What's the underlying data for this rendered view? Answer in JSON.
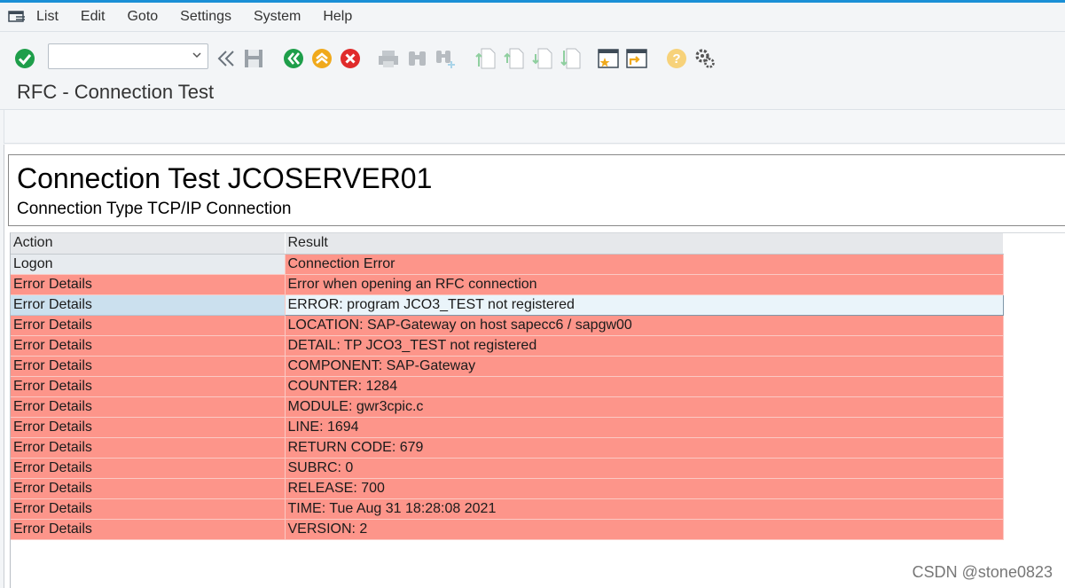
{
  "menu": [
    "List",
    "Edit",
    "Goto",
    "Settings",
    "System",
    "Help"
  ],
  "toolbar": {
    "command_value": "",
    "icons": [
      "enter-icon",
      "back-double-icon",
      "save-icon",
      "back-icon",
      "exit-icon",
      "cancel-icon",
      "print-icon",
      "find-icon",
      "find-next-icon",
      "first-page-icon",
      "previous-page-icon",
      "next-page-icon",
      "last-page-icon",
      "create-session-icon",
      "shortcut-icon",
      "help-icon",
      "customize-icon"
    ]
  },
  "title": "RFC - Connection Test",
  "report": {
    "heading": "Connection Test JCOSERVER01",
    "subheading": "Connection Type TCP/IP Connection"
  },
  "table": {
    "columns": [
      "Action",
      "Result"
    ],
    "rows": [
      {
        "action": "Logon",
        "result": "Connection Error"
      },
      {
        "action": "Error Details",
        "result": "Error when opening an RFC connection"
      },
      {
        "action": "Error Details",
        "result": "ERROR: program JCO3_TEST not registered"
      },
      {
        "action": "Error Details",
        "result": "LOCATION: SAP-Gateway on host sapecc6 / sapgw00"
      },
      {
        "action": "Error Details",
        "result": "DETAIL: TP JCO3_TEST not registered"
      },
      {
        "action": "Error Details",
        "result": "COMPONENT: SAP-Gateway"
      },
      {
        "action": "Error Details",
        "result": "COUNTER: 1284"
      },
      {
        "action": "Error Details",
        "result": "MODULE: gwr3cpic.c"
      },
      {
        "action": "Error Details",
        "result": "LINE: 1694"
      },
      {
        "action": "Error Details",
        "result": "RETURN CODE: 679"
      },
      {
        "action": "Error Details",
        "result": "SUBRC: 0"
      },
      {
        "action": "Error Details",
        "result": "RELEASE: 700"
      },
      {
        "action": "Error Details",
        "result": "TIME: Tue Aug 31 18:28:08 2021"
      },
      {
        "action": "Error Details",
        "result": "VERSION: 2"
      }
    ]
  },
  "watermark": "CSDN @stone0823",
  "colors": {
    "accent": "#1a8fd6",
    "error_row": "#fd958a",
    "selected_row": "#eaf4fa"
  }
}
